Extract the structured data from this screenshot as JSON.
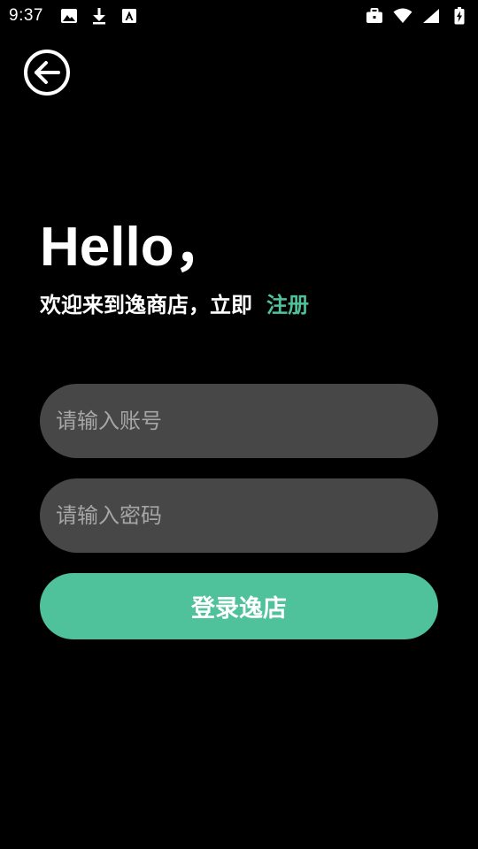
{
  "status_bar": {
    "time": "9:37",
    "left_icons": [
      "image-icon",
      "download-icon",
      "font-icon"
    ],
    "right_icons": [
      "briefcase-icon",
      "wifi-icon",
      "cell-signal-icon",
      "battery-charging-icon"
    ]
  },
  "back_button": {
    "icon": "back-arrow-icon"
  },
  "greeting": {
    "title": "Hello，",
    "welcome_text": "欢迎来到逸商店，立即",
    "register_link": "注册"
  },
  "form": {
    "account_placeholder": "请输入账号",
    "account_value": "",
    "password_placeholder": "请输入密码",
    "password_value": "",
    "login_label": "登录逸店"
  },
  "colors": {
    "background": "#000000",
    "accent": "#4fc19b",
    "input_background": "#474747",
    "placeholder": "#a6a6a6",
    "text": "#ffffff"
  }
}
